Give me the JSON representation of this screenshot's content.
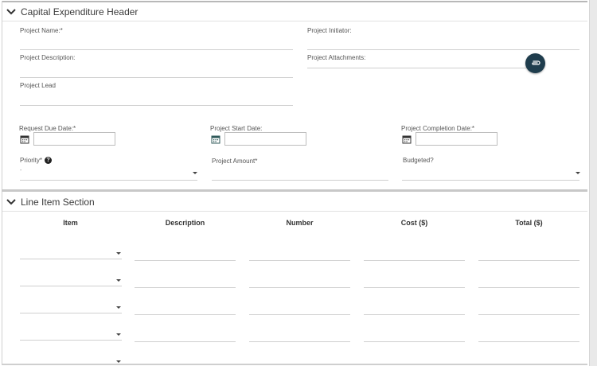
{
  "header_section": {
    "title": "Capital Expenditure Header",
    "project_name_label": "Project Name:*",
    "project_initiator_label": "Project Initiator:",
    "project_description_label": "Project Description:",
    "project_attachments_label": "Project Attachments:",
    "project_lead_label": "Project Lead",
    "request_due_date_label": "Request Due Date:*",
    "project_start_date_label": "Project Start Date:",
    "project_completion_date_label": "Project Completion Date:*",
    "priority_label": "Priority*",
    "priority_value": "-",
    "project_amount_label": "Project Amount*",
    "budgeted_label": "Budgeted?"
  },
  "line_item_section": {
    "title": "Line Item Section",
    "columns": [
      "Item",
      "Description",
      "Number",
      "Cost ($)",
      "Total ($)"
    ],
    "row_count": 5
  },
  "colors": {
    "attach_button": "#1f3d4d",
    "calendar_icon": "#2f5a5a"
  },
  "icons": {
    "collapse": "chevron-down-icon",
    "attach": "paperclip-icon",
    "calendar": "calendar-icon",
    "help": "help-circle-icon",
    "dropdown": "caret-down-icon"
  }
}
